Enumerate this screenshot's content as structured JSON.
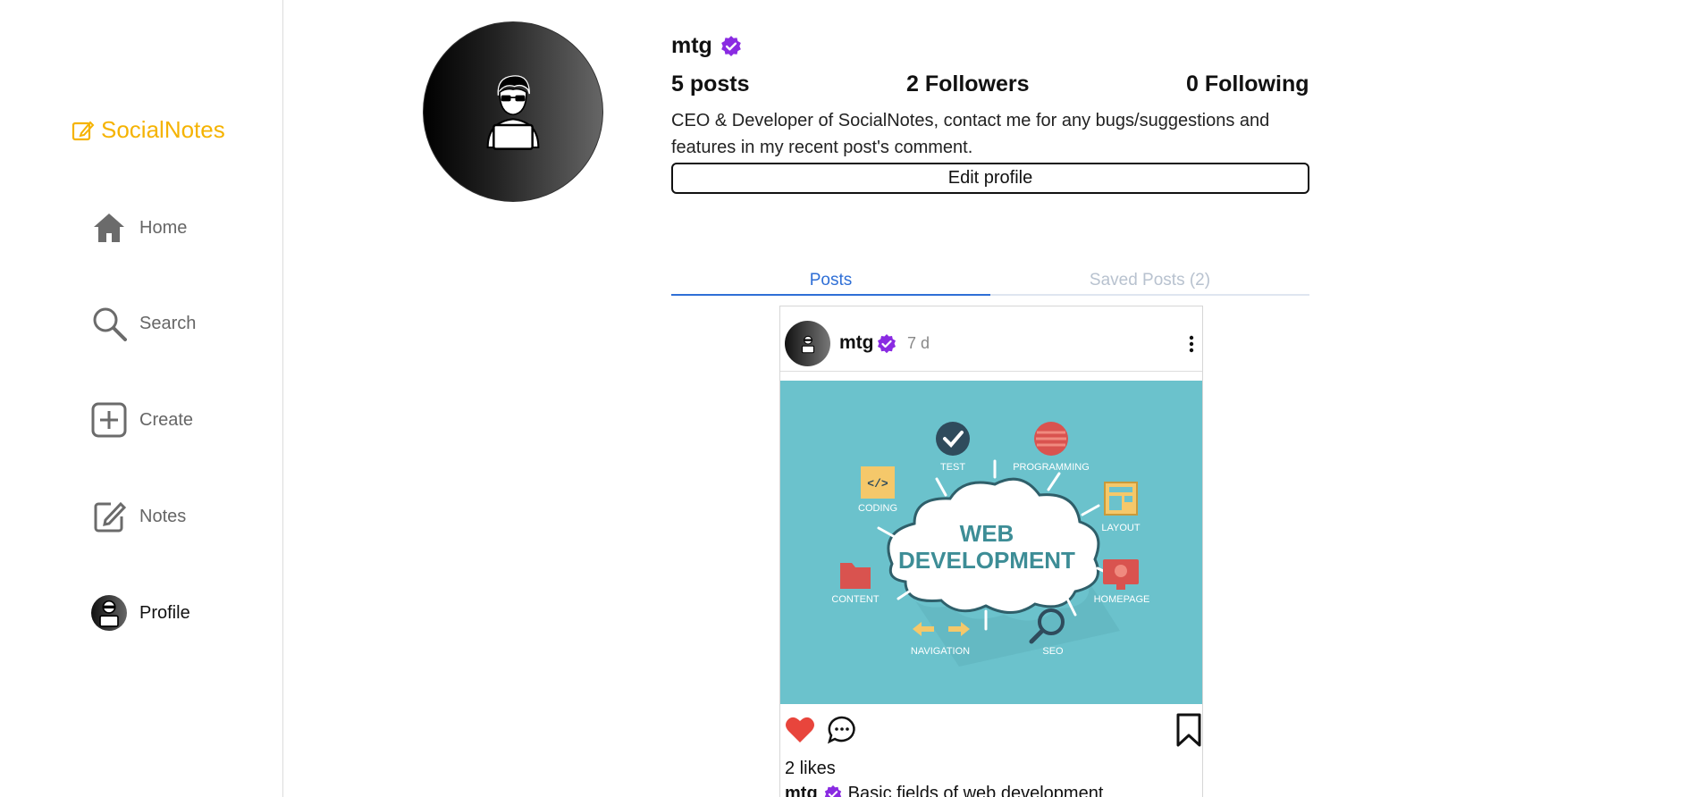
{
  "app": {
    "name": "SocialNotes",
    "brand_color": "#f5b301"
  },
  "sidebar": {
    "items": [
      {
        "label": "Home",
        "icon": "home-icon"
      },
      {
        "label": "Search",
        "icon": "search-icon"
      },
      {
        "label": "Create",
        "icon": "plus-square-icon"
      },
      {
        "label": "Notes",
        "icon": "edit-note-icon"
      },
      {
        "label": "Profile",
        "icon": "avatar",
        "active": true
      }
    ]
  },
  "profile": {
    "username": "mtg",
    "verified": true,
    "posts": "5 posts",
    "followers": "2 Followers",
    "following": "0 Following",
    "bio": "CEO & Developer of SocialNotes, contact me for any bugs/suggestions and features in my recent post's comment.",
    "edit_label": "Edit profile"
  },
  "tabs": [
    {
      "label": "Posts",
      "active": true
    },
    {
      "label": "Saved Posts (2)",
      "active": false
    }
  ],
  "post": {
    "username": "mtg",
    "time": "7 d",
    "image": {
      "title_line1": "WEB",
      "title_line2": "DEVELOPMENT",
      "labels": {
        "test": "TEST",
        "programming": "PROGRAMMING",
        "coding": "CODING",
        "layout": "LAYOUT",
        "content": "CONTENT",
        "homepage": "HOMEPAGE",
        "navigation": "NAVIGATION",
        "seo": "SEO"
      },
      "background": "#6bc2cc"
    },
    "liked": true,
    "likes": "2 likes",
    "caption": "Basic fields of web development"
  },
  "colors": {
    "verified": "#8a2be2",
    "tab_active": "#2f6fd6",
    "like": "#e8453c"
  }
}
